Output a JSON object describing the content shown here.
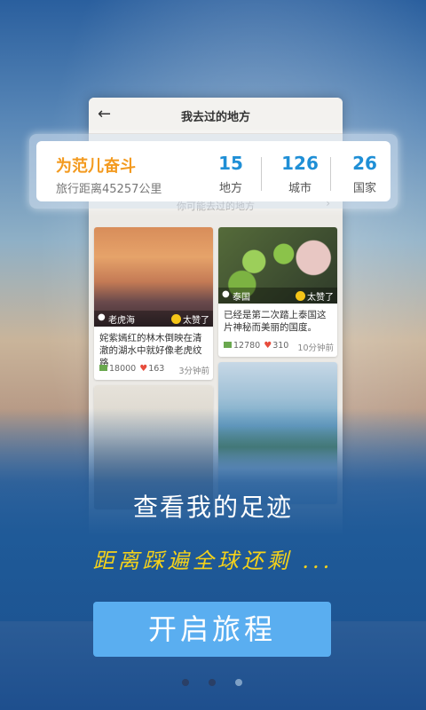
{
  "phone": {
    "title": "我去过的地方",
    "hint": "你可能去过的地方",
    "cards": [
      {
        "location": "老虎海",
        "like": "太赞了",
        "text": "姹紫嫣红的林木倒映在清澈的湖水中就好像老虎纹路",
        "comments": "18000",
        "likes": "163",
        "time": "3分钟前"
      },
      {
        "location": "泰国",
        "like": "太赞了",
        "text": "已经是第二次踏上泰国这片神秘而美丽的国度。",
        "comments": "12780",
        "likes": "310",
        "time": "10分钟前"
      }
    ]
  },
  "stats": {
    "user_name": "为范儿奋斗",
    "distance": "旅行距离45257公里",
    "places": {
      "value": "15",
      "label": "地方"
    },
    "cities": {
      "value": "126",
      "label": "城市"
    },
    "countries": {
      "value": "26",
      "label": "国家"
    }
  },
  "headline": "查看我的足迹",
  "tagline": "距离踩遍全球还剩 ...",
  "start_button": "开启旅程",
  "pager": {
    "count": 3,
    "active_index": 2
  },
  "colors": {
    "accent": "#5aaef0",
    "name": "#f39a1f",
    "stat": "#1f8fd6",
    "tagline": "#f5d21a"
  }
}
